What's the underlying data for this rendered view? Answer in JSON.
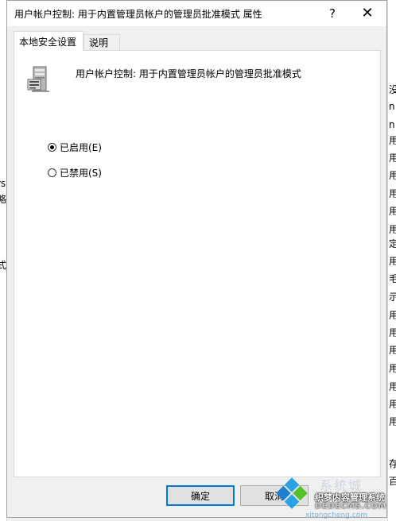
{
  "window": {
    "title": "用户帐户控制: 用于内置管理员帐户的管理员批准模式 属性",
    "help_glyph": "?",
    "close_glyph": "✕"
  },
  "tabs": [
    {
      "label": "本地安全设置",
      "active": true
    },
    {
      "label": "说明",
      "active": false
    }
  ],
  "policy": {
    "icon": "server-computer-icon",
    "name": "用户帐户控制: 用于内置管理员帐户的管理员批准模式"
  },
  "options": [
    {
      "label": "已启用(E)",
      "checked": true
    },
    {
      "label": "已禁用(S)",
      "checked": false
    }
  ],
  "buttons": {
    "ok": "确定",
    "cancel": "取消"
  },
  "background_fragments": {
    "right": [
      "没",
      "n",
      "n",
      "用",
      "用",
      "用",
      "用",
      "用",
      "用",
      "定",
      "用",
      "毛",
      "示",
      "用",
      "用",
      "用",
      "用",
      "用",
      "用",
      "用",
      "存",
      "百"
    ],
    "left": [
      "(",
      "rs",
      "略",
      "式"
    ]
  },
  "watermark": {
    "brand": "系统城",
    "main": "织梦内容管理系统",
    "sub": "DEDECMS.COM",
    "site": "xitongcheng.com"
  }
}
